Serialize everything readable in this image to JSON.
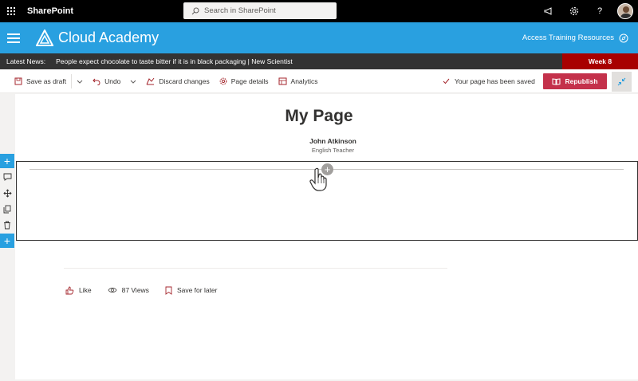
{
  "suite": {
    "app_name": "SharePoint",
    "search_placeholder": "Search in SharePoint"
  },
  "hub": {
    "site_title": "Cloud Academy",
    "link_label": "Access Training Resources"
  },
  "news": {
    "label": "Latest News:",
    "headline": "People expect chocolate to taste bitter if it is in black packaging | New Scientist",
    "week_badge": "Week 8"
  },
  "command_bar": {
    "save_as_draft": "Save as draft",
    "undo": "Undo",
    "discard_changes": "Discard changes",
    "page_details": "Page details",
    "analytics": "Analytics",
    "saved_status": "Your page has been saved",
    "republish": "Republish"
  },
  "page": {
    "title": "My Page",
    "author_name": "John Atkinson",
    "author_role": "English Teacher"
  },
  "social": {
    "like": "Like",
    "views": "87 Views",
    "save_for_later": "Save for later"
  },
  "colors": {
    "hub_blue": "#29a0e0",
    "news_bar": "#333333",
    "week_badge": "#a80000",
    "republish": "#c4314b",
    "accent_red": "#a4262c"
  }
}
